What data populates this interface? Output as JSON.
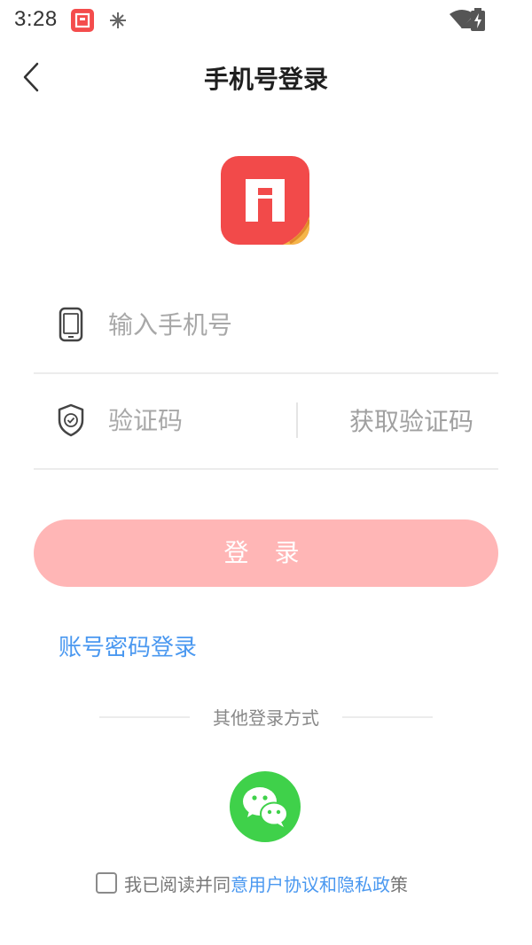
{
  "status_bar": {
    "time": "3:28"
  },
  "header": {
    "title": "手机号登录"
  },
  "form": {
    "phone_placeholder": "输入手机号",
    "phone_value": "",
    "code_placeholder": "验证码",
    "code_value": "",
    "get_code_label": "获取验证码"
  },
  "login_button": {
    "label": "登 录"
  },
  "password_login_link": "账号密码登录",
  "other_login": {
    "label": "其他登录方式"
  },
  "agreement": {
    "prefix": "我已阅读并同",
    "link1": "意用户协议",
    "and": "和",
    "link2": "隐私政",
    "suffix": "策"
  },
  "colors": {
    "accent_red": "#f24a4a",
    "login_button_disabled": "#ffb6b6",
    "link_blue": "#4a98f0",
    "wechat_green": "#3fd14a"
  }
}
